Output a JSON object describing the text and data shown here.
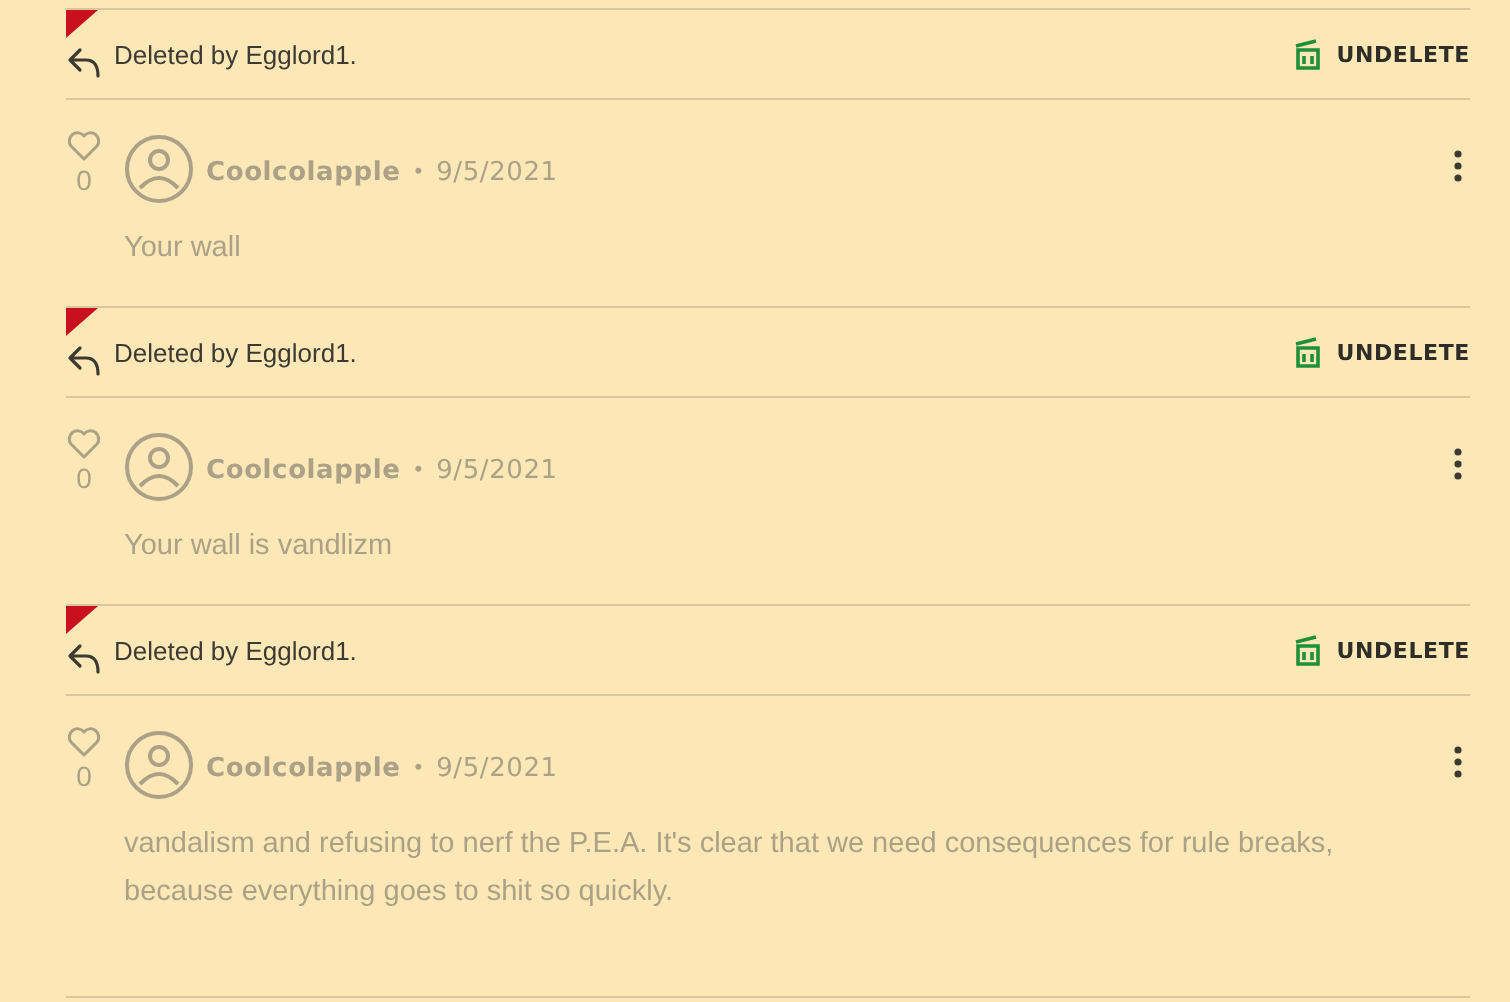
{
  "entries": [
    {
      "kind": "deleted",
      "deleted_notice": "Deleted by Egglord1.",
      "undelete_label": "UNDELETE"
    },
    {
      "kind": "comment",
      "comment": {
        "likes": "0",
        "author": "Coolcolapple",
        "separator": "•",
        "date": "9/5/2021",
        "body": "Your wall"
      }
    },
    {
      "kind": "deleted",
      "deleted_notice": "Deleted by Egglord1.",
      "undelete_label": "UNDELETE"
    },
    {
      "kind": "comment",
      "comment": {
        "likes": "0",
        "author": "Coolcolapple",
        "separator": "•",
        "date": "9/5/2021",
        "body": "Your wall is vandlizm"
      }
    },
    {
      "kind": "deleted",
      "deleted_notice": "Deleted by Egglord1.",
      "undelete_label": "UNDELETE"
    },
    {
      "kind": "comment",
      "comment": {
        "likes": "0",
        "author": "Coolcolapple",
        "separator": "•",
        "date": "9/5/2021",
        "body": "vandalism and refusing to nerf the P.E.A. It's clear that we need consequences for rule breaks, because everything goes to shit so quickly."
      }
    }
  ]
}
